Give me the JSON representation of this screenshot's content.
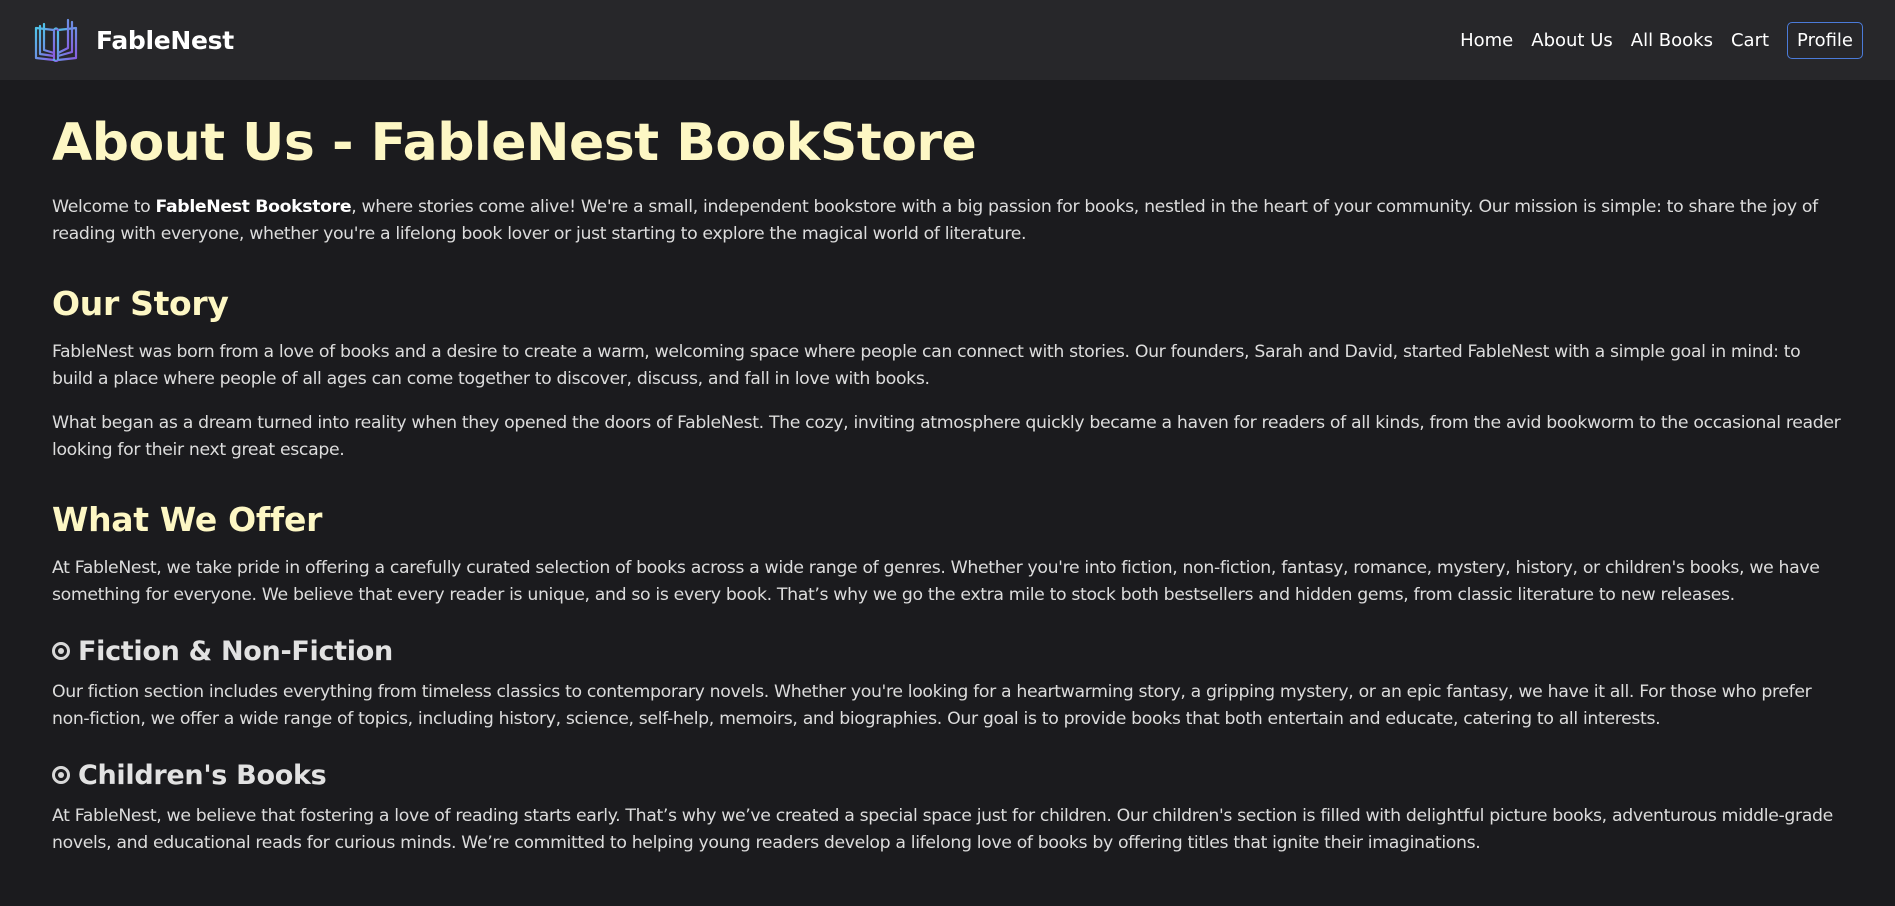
{
  "navbar": {
    "brand": "FableNest",
    "links": [
      "Home",
      "About Us",
      "All Books",
      "Cart"
    ],
    "profile": "Profile"
  },
  "page": {
    "title": "About Us - FableNest BookStore",
    "intro": {
      "before": "Welcome to ",
      "bold": "FableNest Bookstore",
      "after": ", where stories come alive! We're a small, independent bookstore with a big passion for books, nestled in the heart of your community. Our mission is simple: to share the joy of reading with everyone, whether you're a lifelong book lover or just starting to explore the magical world of literature."
    }
  },
  "story": {
    "title": "Our Story",
    "p1": "FableNest was born from a love of books and a desire to create a warm, welcoming space where people can connect with stories. Our founders, Sarah and David, started FableNest with a simple goal in mind: to build a place where people of all ages can come together to discover, discuss, and fall in love with books.",
    "p2": "What began as a dream turned into reality when they opened the doors of FableNest. The cozy, inviting atmosphere quickly became a haven for readers of all kinds, from the avid bookworm to the occasional reader looking for their next great escape."
  },
  "offer": {
    "title": "What We Offer",
    "p1": "At FableNest, we take pride in offering a carefully curated selection of books across a wide range of genres. Whether you're into fiction, non-fiction, fantasy, romance, mystery, history, or children's books, we have something for everyone. We believe that every reader is unique, and so is every book. That’s why we go the extra mile to stock both bestsellers and hidden gems, from classic literature to new releases."
  },
  "fiction": {
    "title": "Fiction & Non-Fiction",
    "icon": "radio-circle-icon",
    "p1": "Our fiction section includes everything from timeless classics to contemporary novels. Whether you're looking for a heartwarming story, a gripping mystery, or an epic fantasy, we have it all. For those who prefer non-fiction, we offer a wide range of topics, including history, science, self-help, memoirs, and biographies. Our goal is to provide books that both entertain and educate, catering to all interests."
  },
  "children": {
    "title": "Children's Books",
    "icon": "radio-circle-icon",
    "p1": "At FableNest, we believe that fostering a love of reading starts early. That’s why we’ve created a special space just for children. Our children's section is filled with delightful picture books, adventurous middle-grade novels, and educational reads for curious minds. We’re committed to helping young readers develop a lifelong love of books by offering titles that ignite their imaginations."
  },
  "colors": {
    "background": "#1b1b1e",
    "navbar": "#27272a",
    "heading": "#fdf7c4",
    "profile_border": "#4b7bd9"
  }
}
